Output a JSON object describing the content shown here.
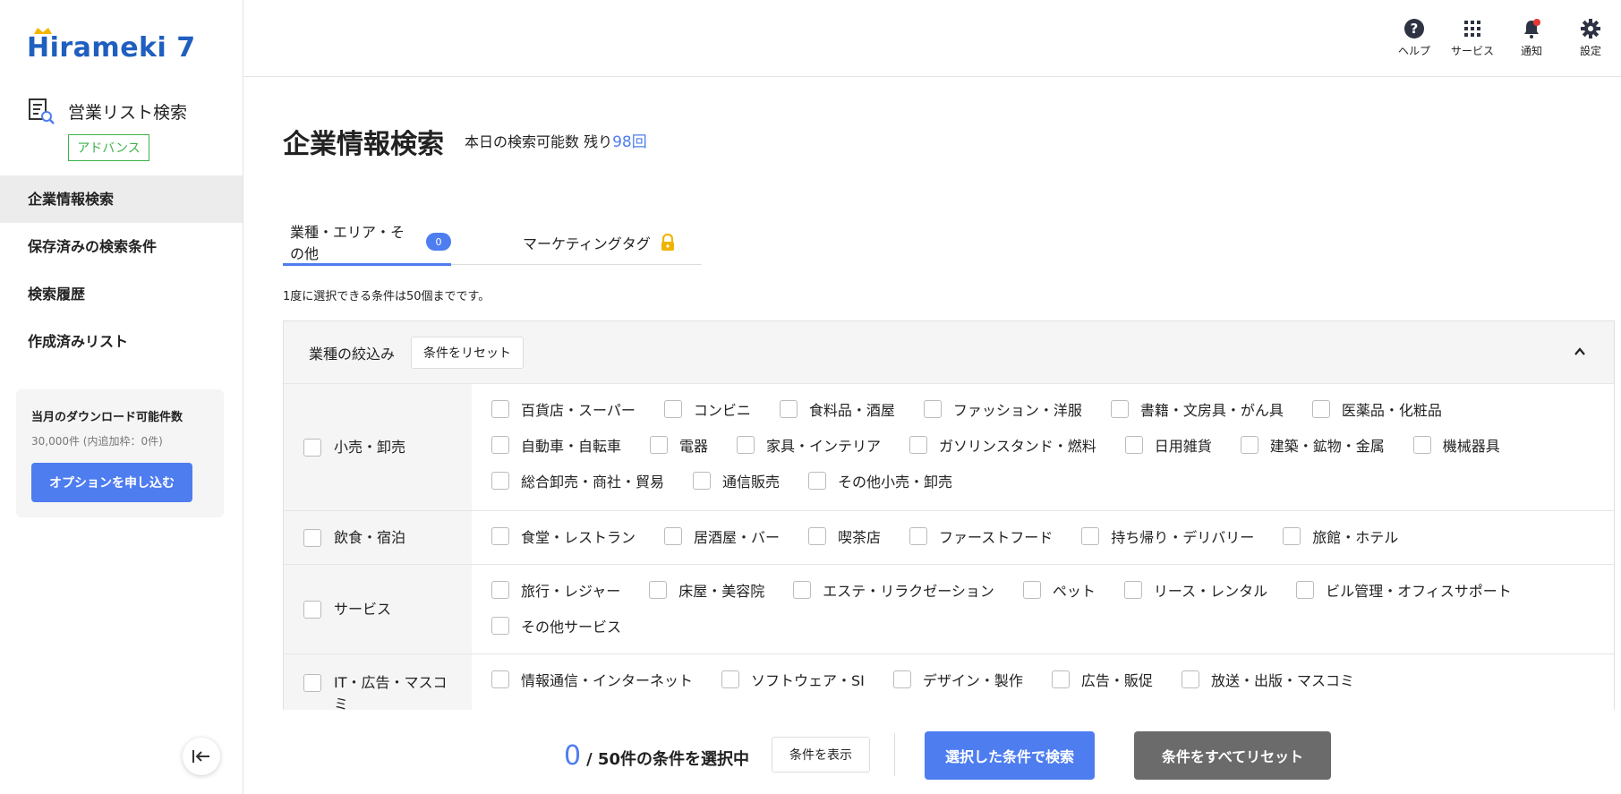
{
  "app": {
    "logo": "Hirameki 7",
    "product_name": "営業リスト検索",
    "plan_badge": "アドバンス"
  },
  "sidebar": {
    "items": [
      {
        "label": "企業情報検索",
        "active": true
      },
      {
        "label": "保存済みの検索条件",
        "active": false
      },
      {
        "label": "検索履歴",
        "active": false
      },
      {
        "label": "作成済みリスト",
        "active": false
      }
    ],
    "download": {
      "title": "当月のダウンロード可能件数",
      "count": "30,000件 (内追加枠：0件)",
      "button": "オプションを申し込む"
    }
  },
  "header": {
    "help": "ヘルプ",
    "services": "サービス",
    "notifications": "通知",
    "settings": "設定"
  },
  "main": {
    "title": "企業情報検索",
    "remaining_prefix": "本日の検索可能数 残り",
    "remaining_value": "98回",
    "tabs": [
      {
        "label": "業種・エリア・その他",
        "badge": "0"
      },
      {
        "label": "マーケティングタグ"
      }
    ],
    "limit_note": "1度に選択できる条件は50個までです。",
    "panel_title": "業種の絞込み",
    "reset_conditions": "条件をリセット",
    "categories": [
      {
        "name": "小売・卸売",
        "options": [
          "百貨店・スーパー",
          "コンビニ",
          "食料品・酒屋",
          "ファッション・洋服",
          "書籍・文房具・がん具",
          "医薬品・化粧品",
          "自動車・自転車",
          "電器",
          "家具・インテリア",
          "ガソリンスタンド・燃料",
          "日用雑貨",
          "建築・鉱物・金属",
          "機械器具",
          "総合卸売・商社・貿易",
          "通信販売",
          "その他小売・卸売"
        ]
      },
      {
        "name": "飲食・宿泊",
        "options": [
          "食堂・レストラン",
          "居酒屋・バー",
          "喫茶店",
          "ファーストフード",
          "持ち帰り・デリバリー",
          "旅館・ホテル"
        ]
      },
      {
        "name": "サービス",
        "options": [
          "旅行・レジャー",
          "床屋・美容院",
          "エステ・リラクゼーション",
          "ペット",
          "リース・レンタル",
          "ビル管理・オフィスサポート",
          "その他サービス"
        ]
      },
      {
        "name": "IT・広告・マスコミ",
        "options": [
          "情報通信・インターネット",
          "ソフトウェア・SI",
          "デザイン・製作",
          "広告・販促",
          "放送・出版・マスコミ"
        ]
      }
    ]
  },
  "footer": {
    "selected": "0",
    "selected_suffix": "/ 50件の条件を選択中",
    "show_conditions": "条件を表示",
    "search": "選択した条件で検索",
    "reset_all": "条件をすべてリセット"
  },
  "colors": {
    "accent": "#4e7df0",
    "badge_green": "#3bb34a",
    "logo_blue": "#1f5fbf"
  }
}
